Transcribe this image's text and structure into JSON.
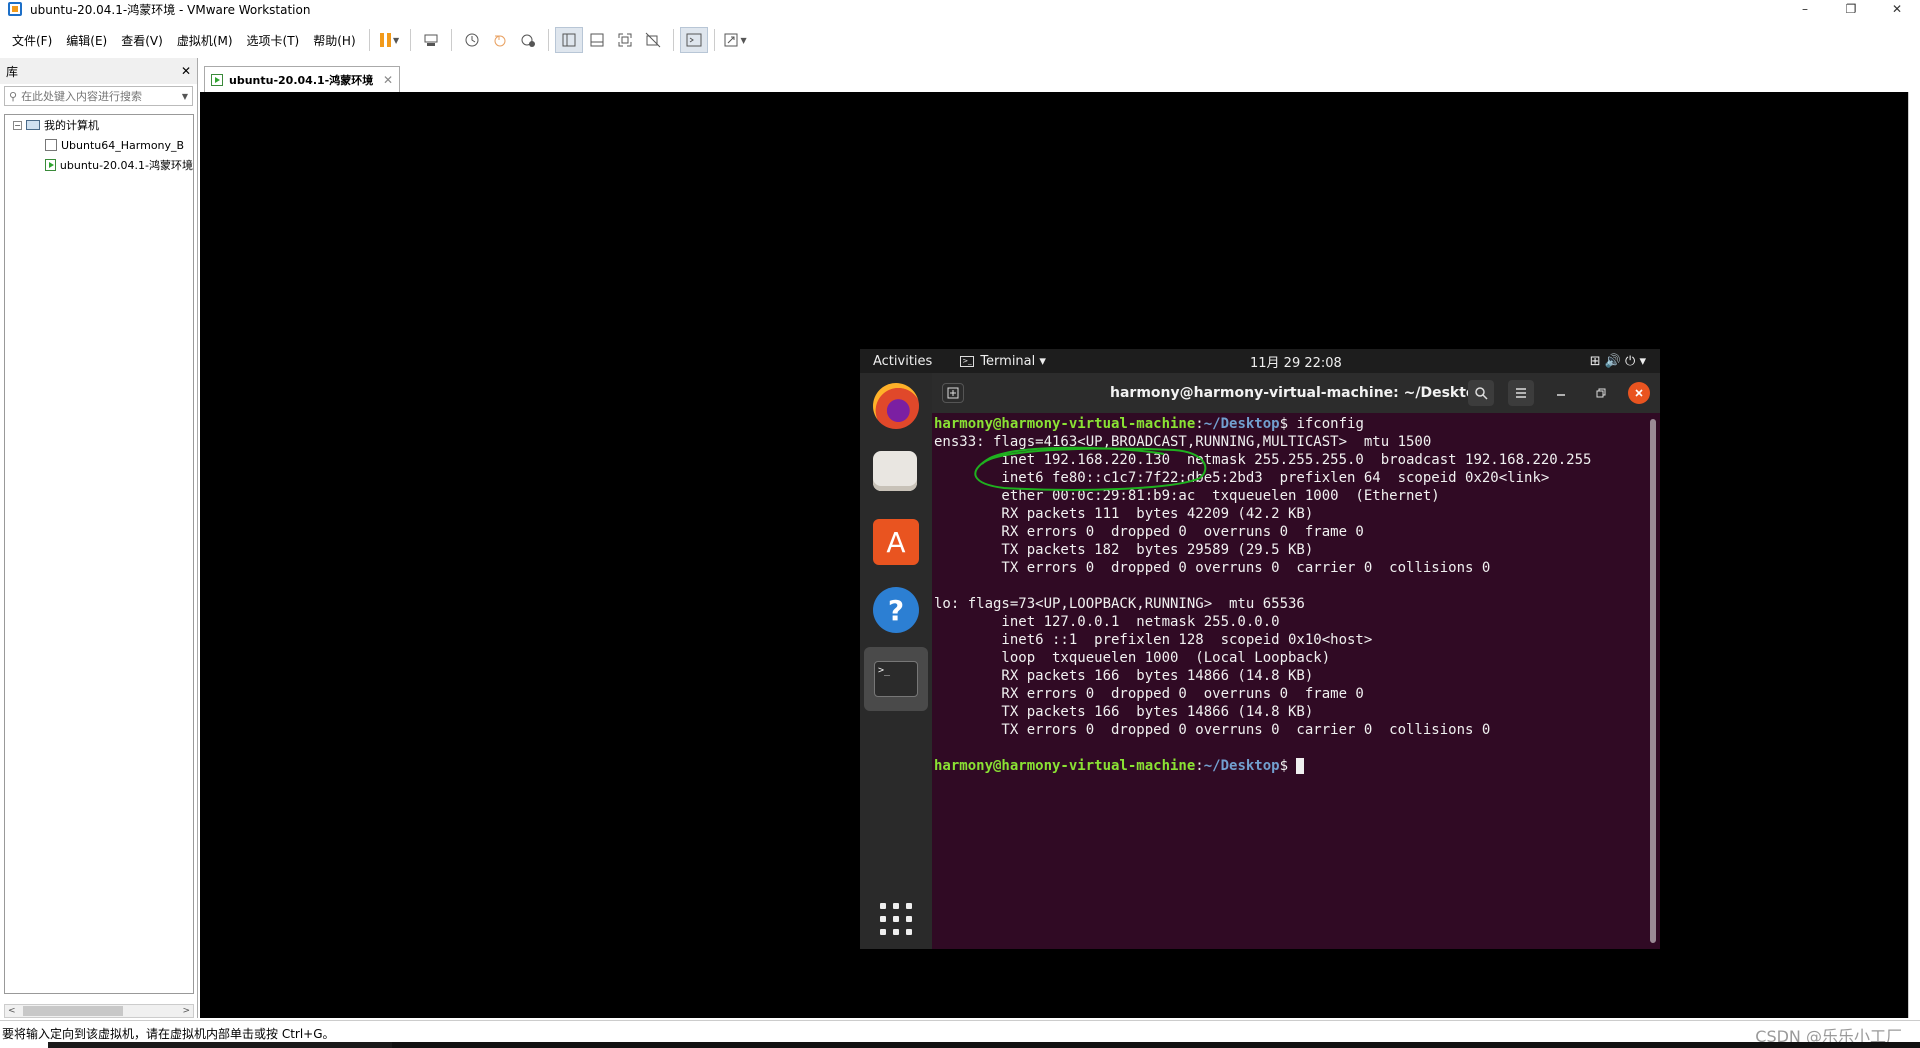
{
  "window": {
    "title": "ubuntu-20.04.1-鸿蒙环境 - VMware Workstation",
    "minimize": "–",
    "restore": "❐",
    "close": "✕"
  },
  "menubar": {
    "items": [
      "文件(F)",
      "编辑(E)",
      "查看(V)",
      "虚拟机(M)",
      "选项卡(T)",
      "帮助(H)"
    ]
  },
  "library": {
    "title": "库",
    "close": "✕",
    "search_placeholder": "在此处键入内容进行搜索",
    "root": "我的计算机",
    "root_expander": "−",
    "vms": [
      "Ubuntu64_Harmony_B",
      "ubuntu-20.04.1-鸿蒙环境"
    ],
    "scroll_left": "<",
    "scroll_right": ">"
  },
  "tab": {
    "label": "ubuntu-20.04.1-鸿蒙环境",
    "close": "✕"
  },
  "ubuntu": {
    "activities": "Activities",
    "app_menu": "Terminal ▾",
    "clock": "11月 29  22:08",
    "tray": "⊞  🔊  ⏻ ▾"
  },
  "terminal": {
    "title": "harmony@harmony-virtual-machine: ~/Desktop",
    "prompt_user": "harmony@harmony-virtual-machine",
    "prompt_sep": ":",
    "prompt_path": "~/Desktop",
    "prompt_end": "$ ",
    "command": "ifconfig",
    "output": "ens33: flags=4163<UP,BROADCAST,RUNNING,MULTICAST>  mtu 1500\n        inet 192.168.220.130  netmask 255.255.255.0  broadcast 192.168.220.255\n        inet6 fe80::c1c7:7f22:dbe5:2bd3  prefixlen 64  scopeid 0x20<link>\n        ether 00:0c:29:81:b9:ac  txqueuelen 1000  (Ethernet)\n        RX packets 111  bytes 42209 (42.2 KB)\n        RX errors 0  dropped 0  overruns 0  frame 0\n        TX packets 182  bytes 29589 (29.5 KB)\n        TX errors 0  dropped 0 overruns 0  carrier 0  collisions 0\n\nlo: flags=73<UP,LOOPBACK,RUNNING>  mtu 65536\n        inet 127.0.0.1  netmask 255.0.0.0\n        inet6 ::1  prefixlen 128  scopeid 0x10<host>\n        loop  txqueuelen 1000  (Local Loopback)\n        RX packets 166  bytes 14866 (14.8 KB)\n        RX errors 0  dropped 0  overruns 0  frame 0\n        TX packets 166  bytes 14866 (14.8 KB)\n        TX errors 0  dropped 0 overruns 0  carrier 0  collisions 0\n"
  },
  "statusbar": {
    "message": "要将输入定向到该虚拟机，请在虚拟机内部单击或按 Ctrl+G。",
    "watermark": "CSDN @乐乐小工厂"
  },
  "colors": {
    "ubuntu_bg": "#300a24",
    "prompt_user": "#8ae234",
    "prompt_path": "#729fcf",
    "annotation": "#1fb01f",
    "accent": "#e95420"
  }
}
